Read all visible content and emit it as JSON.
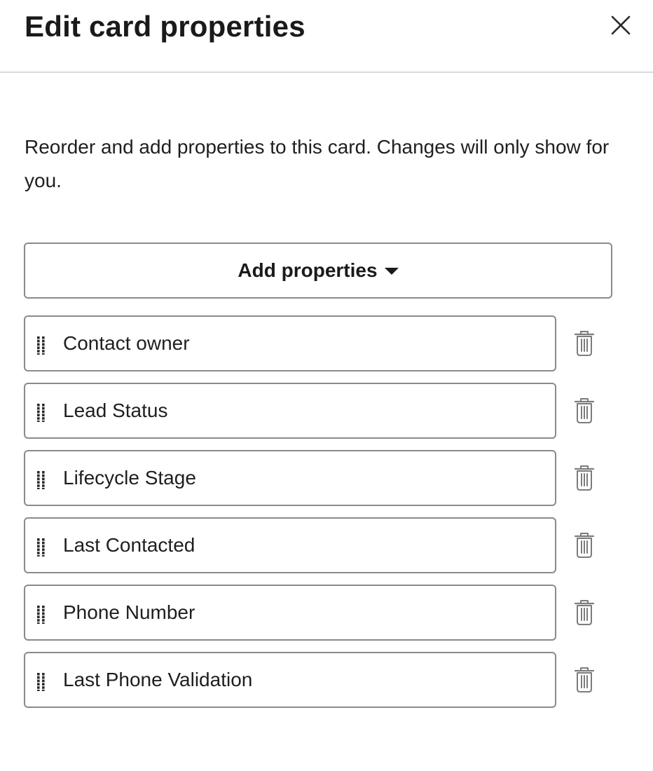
{
  "panel": {
    "title": "Edit card properties",
    "close_icon": "close-icon",
    "description": "Reorder and add properties to this card. Changes will only show for you.",
    "add_button_label": "Add properties",
    "add_button_icon": "caret-down-icon"
  },
  "properties": [
    {
      "label": "Contact owner"
    },
    {
      "label": "Lead Status"
    },
    {
      "label": "Lifecycle Stage"
    },
    {
      "label": "Last Contacted"
    },
    {
      "label": "Phone Number"
    },
    {
      "label": "Last Phone Validation"
    }
  ],
  "icons": {
    "drag": "drag-handle-icon",
    "delete": "trash-icon"
  },
  "colors": {
    "text": "#1f1f1f",
    "border": "#8a8a8a",
    "divider": "#d6d9de",
    "icon_muted": "#7c7c7c"
  }
}
